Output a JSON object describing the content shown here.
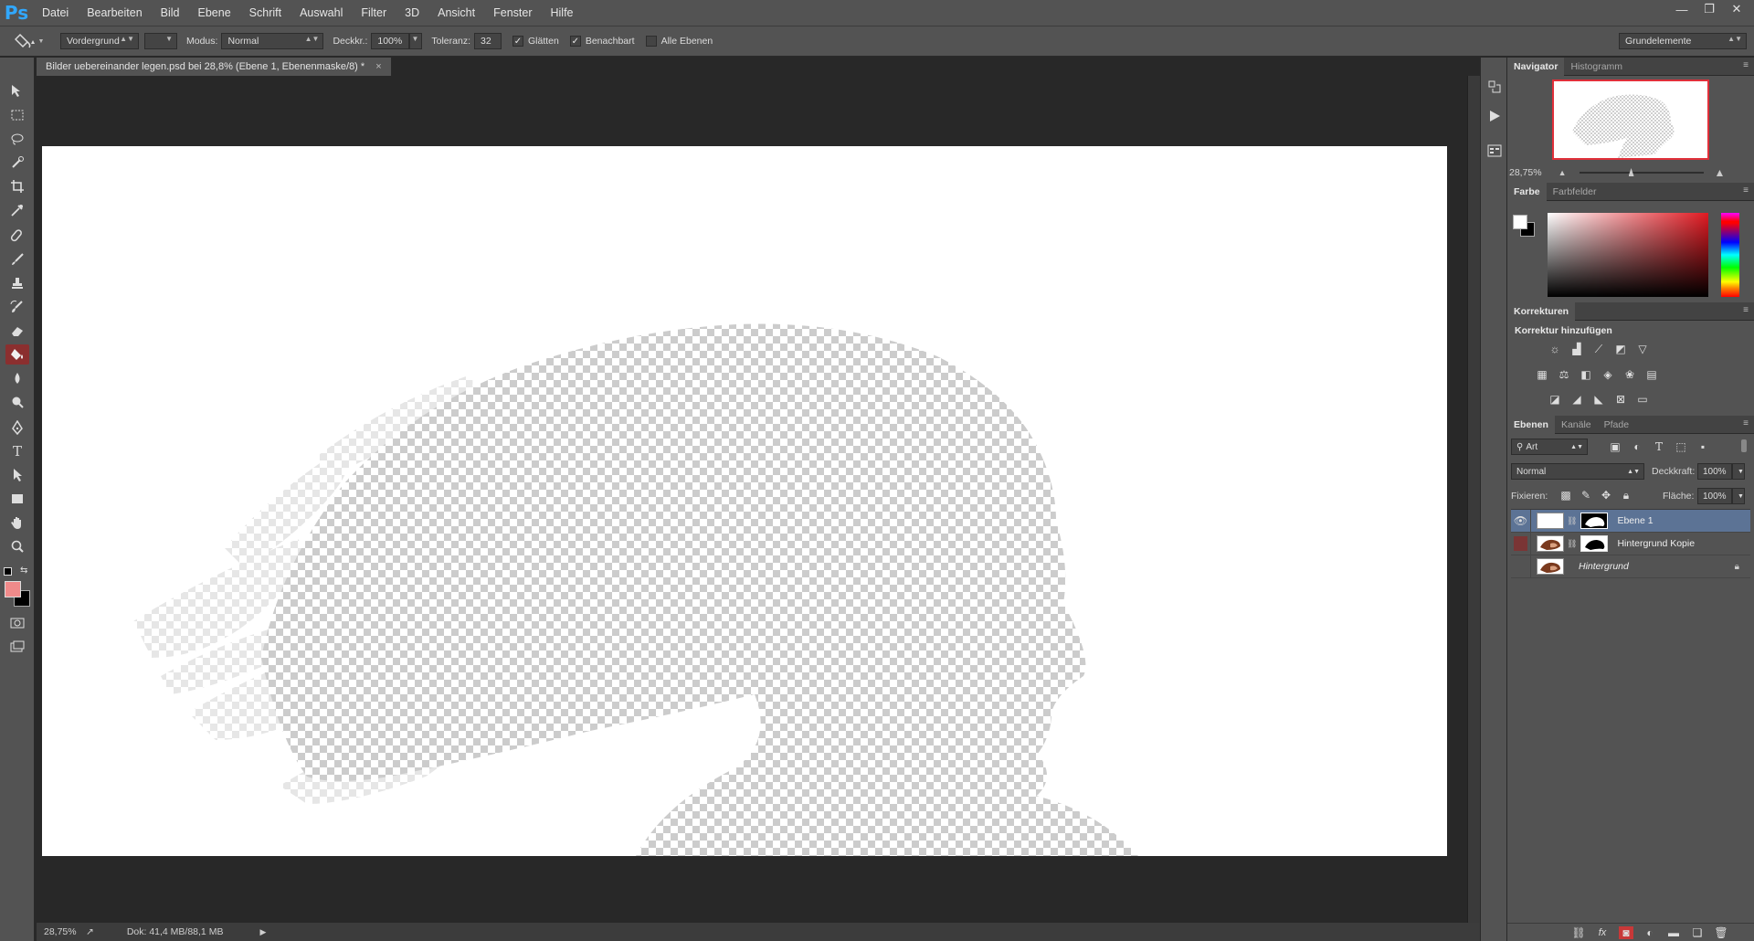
{
  "app": {
    "logo": "Ps"
  },
  "menu": [
    "Datei",
    "Bearbeiten",
    "Bild",
    "Ebene",
    "Schrift",
    "Auswahl",
    "Filter",
    "3D",
    "Ansicht",
    "Fenster",
    "Hilfe"
  ],
  "options": {
    "fill_source": "Vordergrund",
    "mode_label": "Modus:",
    "mode_value": "Normal",
    "opacity_label": "Deckkr.:",
    "opacity_value": "100%",
    "tolerance_label": "Toleranz:",
    "tolerance_value": "32",
    "smooth_label": "Glätten",
    "contiguous_label": "Benachbart",
    "all_layers_label": "Alle Ebenen",
    "workspace": "Grundelemente"
  },
  "document": {
    "tab_title": "Bilder uebereinander legen.psd bei 28,8% (Ebene 1, Ebenenmaske/8) *",
    "close": "×"
  },
  "status": {
    "zoom": "28,75%",
    "doc_size": "Dok: 41,4 MB/88,1 MB"
  },
  "navigator": {
    "tabs": [
      "Navigator",
      "Histogramm"
    ],
    "zoom": "28,75%"
  },
  "color_panel": {
    "tabs": [
      "Farbe",
      "Farbfelder"
    ]
  },
  "adjustments": {
    "tab": "Korrekturen",
    "heading": "Korrektur hinzufügen"
  },
  "layers_panel": {
    "tabs": [
      "Ebenen",
      "Kanäle",
      "Pfade"
    ],
    "filter": "Art",
    "blend_mode": "Normal",
    "opacity_label": "Deckkraft:",
    "opacity_value": "100%",
    "lock_label": "Fixieren:",
    "fill_label": "Fläche:",
    "fill_value": "100%",
    "layers": [
      {
        "name": "Ebene 1",
        "visible": true,
        "selected": true
      },
      {
        "name": "Hintergrund Kopie",
        "visible": false,
        "selected": false
      },
      {
        "name": "Hintergrund",
        "visible": false,
        "selected": false,
        "locked": true
      }
    ]
  },
  "colors": {
    "foreground": "#f08a8a",
    "background": "#000000",
    "selection": "#5c7395",
    "accent_red": "#8b2f2f"
  }
}
